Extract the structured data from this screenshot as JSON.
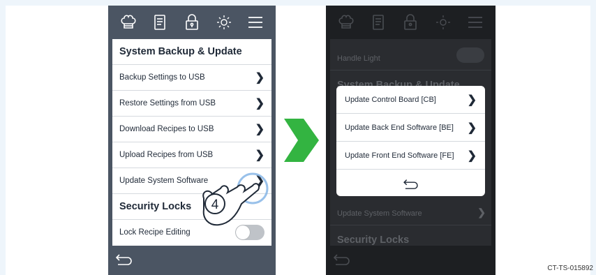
{
  "colors": {
    "phone": "#4b5563",
    "accent": "#33b441",
    "dark_phone": "#1d1f22"
  },
  "left_screen": {
    "section_backup": "System Backup & Update",
    "items": [
      "Backup Settings to USB",
      "Restore Settings from USB",
      "Download Recipes to USB",
      "Upload Recipes from USB",
      "Update System Software"
    ],
    "section_security": "Security Locks",
    "lock_item": "Lock Recipe Editing",
    "lock_enabled": false,
    "step_number": "4"
  },
  "right_screen": {
    "bg_items": {
      "handle_light": "Handle Light",
      "section_backup": "System Backup & Update",
      "update_software": "Update System Software",
      "section_security": "Security Locks"
    },
    "dialog_items": [
      "Update Control Board [CB]",
      "Update Back End Software [BE]",
      "Update Front End Software [FE]"
    ]
  },
  "icons": [
    "chef-hat-icon",
    "recipe-book-icon",
    "lock-icon",
    "brightness-icon",
    "menu-icon",
    "back-icon"
  ],
  "caption": "CT-TS-015892"
}
